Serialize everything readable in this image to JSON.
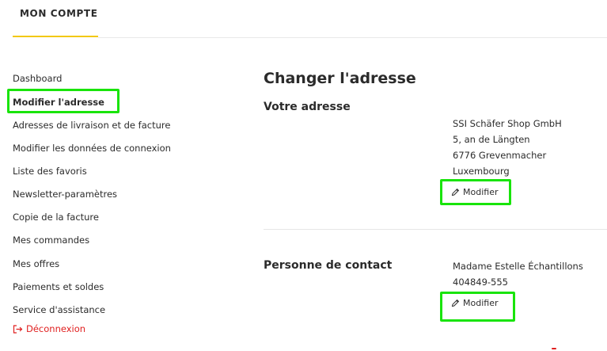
{
  "header": {
    "account_tab": "MON COMPTE",
    "accent_color": "#f2c811"
  },
  "sidebar": {
    "items": [
      {
        "label": "Dashboard",
        "active": false
      },
      {
        "label": "Modifier l'adresse",
        "active": true
      },
      {
        "label": "Adresses de livraison et de facture",
        "active": false
      },
      {
        "label": "Modifier les données de connexion",
        "active": false
      },
      {
        "label": "Liste des favoris",
        "active": false
      },
      {
        "label": "Newsletter-paramètres",
        "active": false
      },
      {
        "label": "Copie de la facture",
        "active": false
      },
      {
        "label": "Mes commandes",
        "active": false
      },
      {
        "label": "Mes offres",
        "active": false
      },
      {
        "label": "Paiements et soldes",
        "active": false
      },
      {
        "label": "Service d'assistance",
        "active": false
      }
    ],
    "logout": {
      "label": "Déconnexion",
      "icon": "logout-icon",
      "color": "#e02020"
    }
  },
  "main": {
    "title": "Changer l'adresse",
    "address_section": {
      "title": "Votre adresse",
      "lines": [
        "SSI Schäfer Shop GmbH",
        "5, an de Längten",
        "6776 Grevenmacher",
        "Luxembourg"
      ],
      "edit_label": "Modifier",
      "edit_icon": "pencil-icon"
    },
    "contact_section": {
      "title": "Personne de contact",
      "lines": [
        "Madame Estelle Échantillons",
        "404849-555"
      ],
      "edit_label": "Modifier",
      "edit_icon": "pencil-icon"
    }
  },
  "highlight_color": "#19e40b"
}
